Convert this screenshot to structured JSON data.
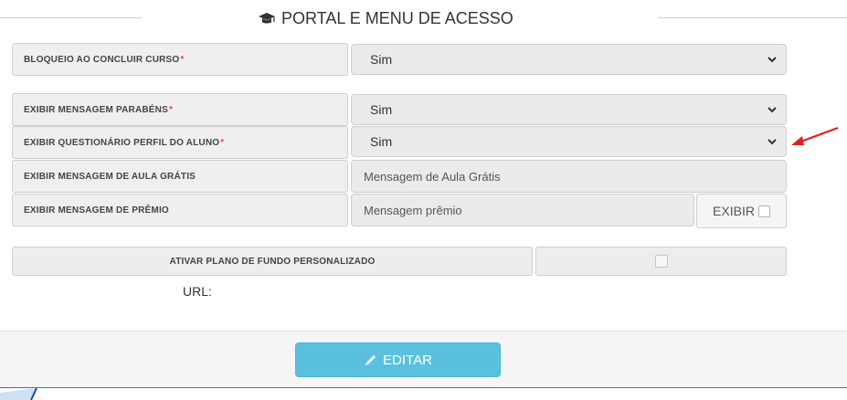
{
  "header": {
    "title": "PORTAL E MENU DE ACESSO",
    "icon": "graduation-cap-icon"
  },
  "fields": {
    "bloqueio": {
      "label": "BLOQUEIO AO CONCLUIR CURSO",
      "required_mark": "*",
      "value": "Sim"
    },
    "parabens": {
      "label": "EXIBIR MENSAGEM PARABÉNS",
      "required_mark": "*",
      "value": "Sim"
    },
    "questionario": {
      "label": "EXIBIR QUESTIONÁRIO PERFIL DO ALUNO",
      "required_mark": "*",
      "value": "Sim"
    },
    "aula_gratis": {
      "label": "EXIBIR MENSAGEM DE AULA GRÁTIS",
      "value": "Mensagem de Aula Grátis"
    },
    "premio": {
      "label": "EXIBIR MENSAGEM DE PRÊMIO",
      "value": "Mensagem prêmio",
      "exibir_label": "EXIBIR",
      "exibir_checked": false
    }
  },
  "plano_fundo": {
    "label": "ATIVAR PLANO DE FUNDO PERSONALIZADO",
    "checked": false,
    "url_label": "URL:"
  },
  "footer": {
    "edit_label": "EDITAR",
    "edit_icon": "pencil-icon"
  },
  "colors": {
    "button": "#5bc0de",
    "required": "#d9534f",
    "annotation_arrow": "#e02020"
  }
}
